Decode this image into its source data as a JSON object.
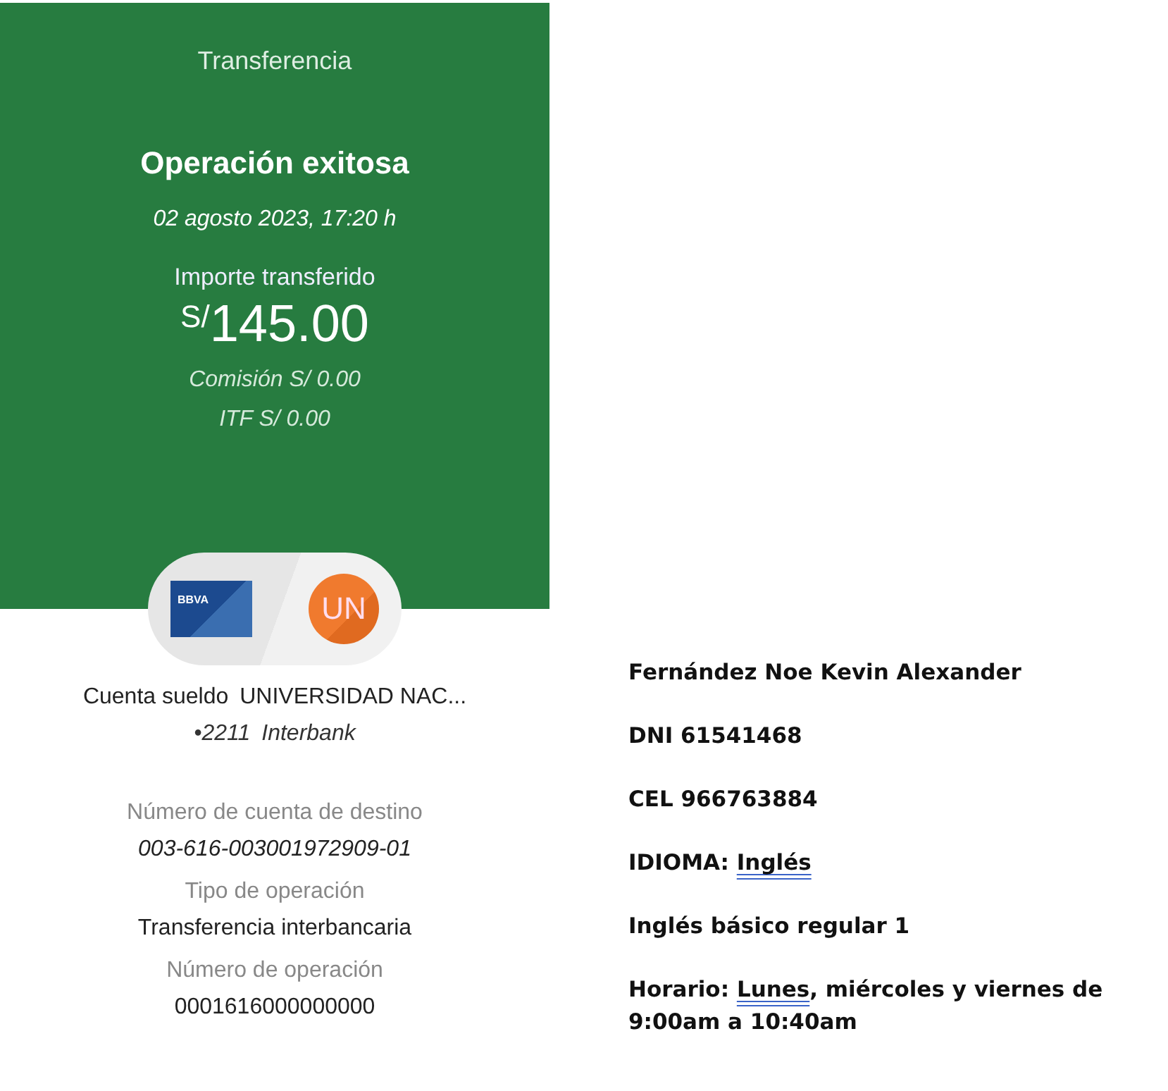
{
  "receipt": {
    "header": "Transferencia",
    "status": "Operación exitosa",
    "datetime": "02 agosto 2023,  17:20 h",
    "amount_label": "Importe transferido",
    "currency": "S/",
    "amount": "145.00",
    "fees": [
      "Comisión  S/ 0.00",
      "ITF  S/ 0.00"
    ],
    "card_logo": "BBVA",
    "avatar": "UN",
    "account": {
      "type": "Cuenta sueldo",
      "name": "UNIVERSIDAD NAC...",
      "number": "•2211",
      "bank": "Interbank"
    },
    "details": [
      {
        "label": "Número de cuenta de destino",
        "value": "003-616-003001972909-01",
        "italic": true
      },
      {
        "label": "Tipo de operación",
        "value": "Transferencia interbancaria",
        "italic": false
      },
      {
        "label": "Número de operación",
        "value": "0001616000000000",
        "italic": false
      }
    ]
  },
  "notes": [
    [
      {
        "text": "Fernández Noe Kevin Alexander",
        "flagged": false
      }
    ],
    [
      {
        "text": "DNI 61541468",
        "flagged": false
      }
    ],
    [
      {
        "text": "CEL 966763884",
        "flagged": false
      }
    ],
    [
      {
        "text": "IDIOMA: ",
        "flagged": false
      },
      {
        "text": "Inglés",
        "flagged": true
      }
    ],
    [
      {
        "text": "Inglés básico regular 1",
        "flagged": false
      }
    ],
    [
      {
        "text": "Horario: ",
        "flagged": false
      },
      {
        "text": "Lunes",
        "flagged": true
      },
      {
        "text": ", miércoles y viernes de 9:00am a 10:40am",
        "flagged": false
      }
    ]
  ]
}
